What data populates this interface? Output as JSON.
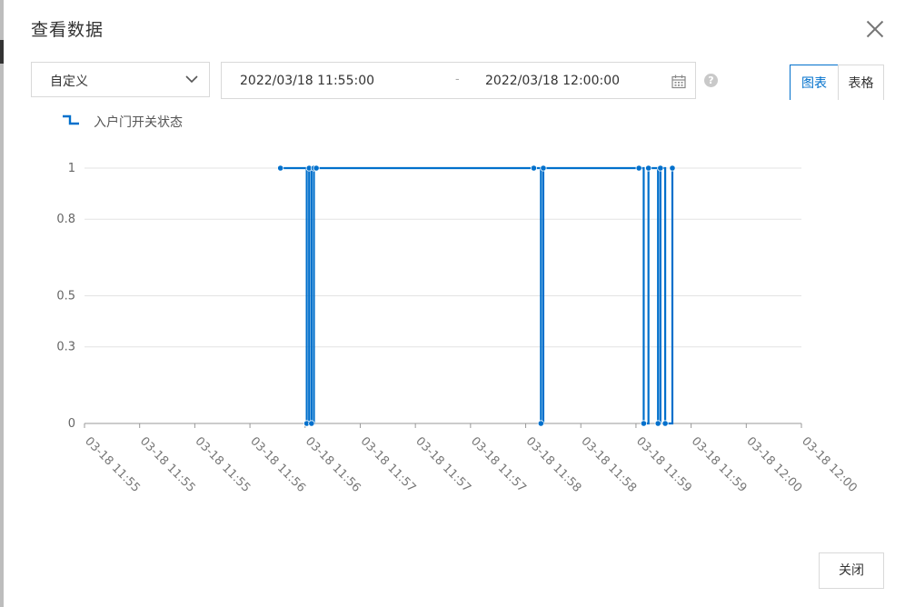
{
  "dialog": {
    "title": "查看数据",
    "close_button": "关闭"
  },
  "filter": {
    "mode": "自定义",
    "range_start": "2022/03/18 11:55:00",
    "range_separator": "-",
    "range_end": "2022/03/18 12:00:00",
    "help": "?"
  },
  "tabs": [
    {
      "label": "图表",
      "active": true
    },
    {
      "label": "表格",
      "active": false
    }
  ],
  "colors": {
    "series": "#0070cc",
    "grid": "#e3e3e3",
    "axis": "#999999",
    "tick_text": "#666666"
  },
  "chart_data": {
    "type": "line",
    "step": true,
    "title": "",
    "xlabel": "",
    "ylabel": "",
    "legend_position": "top-left",
    "grid": true,
    "series": [
      {
        "name": "入户门开关状态",
        "x": [
          "2022-03-18 11:56:22",
          "2022-03-18 11:56:33",
          "2022-03-18 11:56:34",
          "2022-03-18 11:56:35",
          "2022-03-18 11:56:36",
          "2022-03-18 11:56:37",
          "2022-03-18 11:58:08",
          "2022-03-18 11:58:11",
          "2022-03-18 11:58:12",
          "2022-03-18 11:58:52",
          "2022-03-18 11:58:54",
          "2022-03-18 11:58:56",
          "2022-03-18 11:59:00",
          "2022-03-18 11:59:01",
          "2022-03-18 11:59:03",
          "2022-03-18 11:59:06"
        ],
        "values": [
          1,
          0,
          1,
          0,
          1,
          1,
          1,
          0,
          1,
          1,
          0,
          1,
          0,
          1,
          0,
          1
        ]
      }
    ],
    "x_range": [
      "2022-03-18 11:55:00",
      "2022-03-18 12:00:00"
    ],
    "x_tick_labels": [
      "03-18 11:55",
      "03-18 11:55",
      "03-18 11:55",
      "03-18 11:56",
      "03-18 11:56",
      "03-18 11:57",
      "03-18 11:57",
      "03-18 11:57",
      "03-18 11:58",
      "03-18 11:58",
      "03-18 11:59",
      "03-18 11:59",
      "03-18 12:00",
      "03-18 12:00"
    ],
    "y_ticks": [
      0,
      0.3,
      0.5,
      0.8,
      1
    ],
    "y_tick_labels": [
      "0",
      "0.3",
      "0.5",
      "0.8",
      "1"
    ],
    "ylim": [
      0,
      1
    ]
  }
}
